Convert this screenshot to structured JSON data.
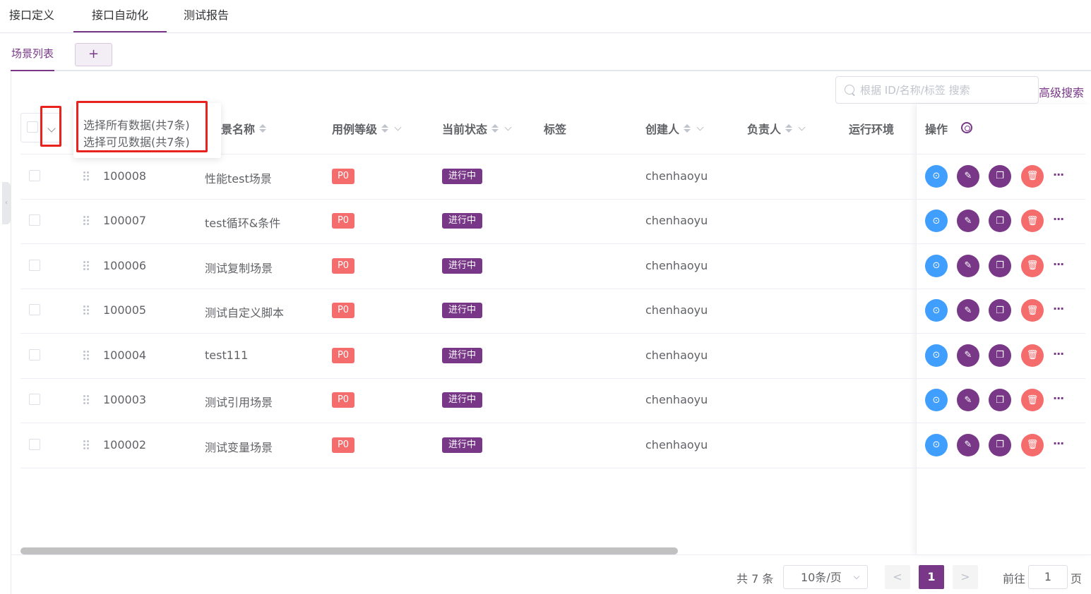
{
  "top_tabs": [
    "接口定义",
    "接口自动化",
    "测试报告"
  ],
  "scene_tab": "场景列表",
  "add_tab": "+",
  "search": {
    "placeholder": "根据 ID/名称/标签 搜索",
    "advanced": "高级搜索"
  },
  "select_popup": {
    "all": "选择所有数据(共7条)",
    "visible": "选择可见数据(共7条)"
  },
  "columns": {
    "name_partial": "景名称",
    "level": "用例等级",
    "status": "当前状态",
    "tags": "标签",
    "creator": "创建人",
    "owner": "负责人",
    "env": "运行环境",
    "ops": "操作"
  },
  "rows": [
    {
      "id": "100008",
      "name": "性能test场景",
      "level": "P0",
      "status": "进行中",
      "creator": "chenhaoyu"
    },
    {
      "id": "100007",
      "name": "test循环&条件",
      "level": "P0",
      "status": "进行中",
      "creator": "chenhaoyu"
    },
    {
      "id": "100006",
      "name": "测试复制场景",
      "level": "P0",
      "status": "进行中",
      "creator": "chenhaoyu"
    },
    {
      "id": "100005",
      "name": "测试自定义脚本",
      "level": "P0",
      "status": "进行中",
      "creator": "chenhaoyu"
    },
    {
      "id": "100004",
      "name": "test111",
      "level": "P0",
      "status": "进行中",
      "creator": "chenhaoyu"
    },
    {
      "id": "100003",
      "name": "测试引用场景",
      "level": "P0",
      "status": "进行中",
      "creator": "chenhaoyu"
    },
    {
      "id": "100002",
      "name": "测试变量场景",
      "level": "P0",
      "status": "进行中",
      "creator": "chenhaoyu"
    }
  ],
  "more": "···",
  "pagination": {
    "total": "共 7 条",
    "page_size": "10条/页",
    "prev": "<",
    "current": "1",
    "next": ">",
    "goto_label": "前往",
    "goto_value": "1",
    "goto_unit": "页"
  },
  "colors": {
    "accent": "#783887",
    "danger": "#f56c6c",
    "run": "#409eff",
    "highlight": "#e8231e"
  },
  "icons": [
    "search-icon",
    "chevron-down-icon",
    "sort-icon",
    "filter-icon",
    "gear-icon",
    "drag-handle-icon",
    "run-icon",
    "edit-icon",
    "copy-icon",
    "delete-icon",
    "more-icon",
    "collapse-icon"
  ]
}
